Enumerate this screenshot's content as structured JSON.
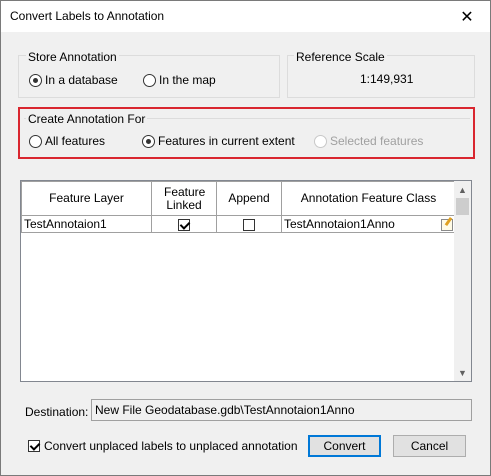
{
  "window": {
    "title": "Convert Labels to Annotation",
    "close_glyph": "✕"
  },
  "store_annotation": {
    "label": "Store Annotation",
    "options": [
      {
        "label": "In a database",
        "checked": true
      },
      {
        "label": "In the map",
        "checked": false
      }
    ]
  },
  "reference_scale": {
    "label": "Reference Scale",
    "value": "1:149,931"
  },
  "create_for": {
    "label": "Create Annotation For",
    "options": [
      {
        "label": "All features",
        "checked": false,
        "enabled": true
      },
      {
        "label": "Features in current extent",
        "checked": true,
        "enabled": true
      },
      {
        "label": "Selected features",
        "checked": false,
        "enabled": false
      }
    ]
  },
  "table": {
    "headers": [
      "Feature Layer",
      "Feature Linked",
      "Append",
      "Annotation Feature Class"
    ],
    "rows": [
      {
        "layer": "TestAnnotaion1",
        "linked": true,
        "append": false,
        "class": "TestAnnotaion1Anno",
        "icon": "edit-icon"
      }
    ]
  },
  "destination": {
    "label": "Destination:",
    "value": "New File Geodatabase.gdb\\TestAnnotaion1Anno"
  },
  "convert_unplaced": {
    "label": "Convert unplaced labels to unplaced annotation",
    "checked": true
  },
  "buttons": {
    "convert": "Convert",
    "cancel": "Cancel"
  },
  "colors": {
    "highlight_border": "#d9262f",
    "default_button_border": "#0078d7"
  }
}
